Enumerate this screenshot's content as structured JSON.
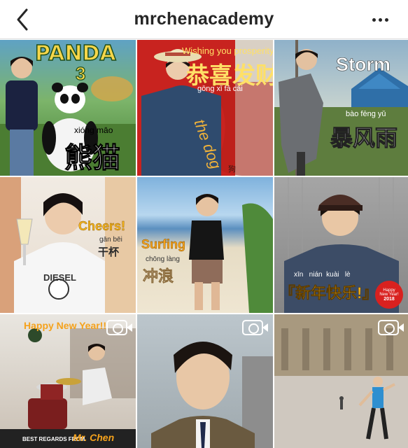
{
  "header": {
    "title": "mrchenacademy",
    "back_icon": "chevron-left-icon",
    "more_icon": "ellipsis-icon"
  },
  "posts": [
    {
      "id": "panda",
      "title_line1": "PANDA",
      "title_line2": "3",
      "pinyin": "xióng māo",
      "hanzi": "熊猫"
    },
    {
      "id": "prosperity",
      "english": "Wishing you prosperity",
      "hanzi": "恭喜发财",
      "pinyin": "gōng xǐ fā cái",
      "dog_text": "the dog",
      "seal": "狗"
    },
    {
      "id": "storm",
      "english": "Storm",
      "pinyin": "bào fēng yǔ",
      "hanzi": "暴风雨"
    },
    {
      "id": "cheers",
      "english": "Cheers!",
      "pinyin": "gān bēi",
      "hanzi": "干杯",
      "shirt_text": "DIESEL"
    },
    {
      "id": "surfing",
      "english": "Surfing",
      "pinyin": "chōng làng",
      "hanzi": "冲浪"
    },
    {
      "id": "new-year",
      "pinyin": "xīn   nián  kuài   lè",
      "hanzi": "『新年快乐!』",
      "badge_line1": "Happy",
      "badge_line2": "New Year!",
      "badge_line3": "2018"
    },
    {
      "id": "drums",
      "heading": "Happy New Year!!",
      "footer_small": "BEST REGARDS FROM",
      "footer_name": "Mr. Chen",
      "is_video": true
    },
    {
      "id": "selfie",
      "is_video": true
    },
    {
      "id": "plaza",
      "is_video": true
    }
  ],
  "colors": {
    "header_text": "#262626",
    "divider": "#dbdbdb",
    "new_year_orange": "#f5a21c",
    "prosperity_red": "#c8231f"
  }
}
